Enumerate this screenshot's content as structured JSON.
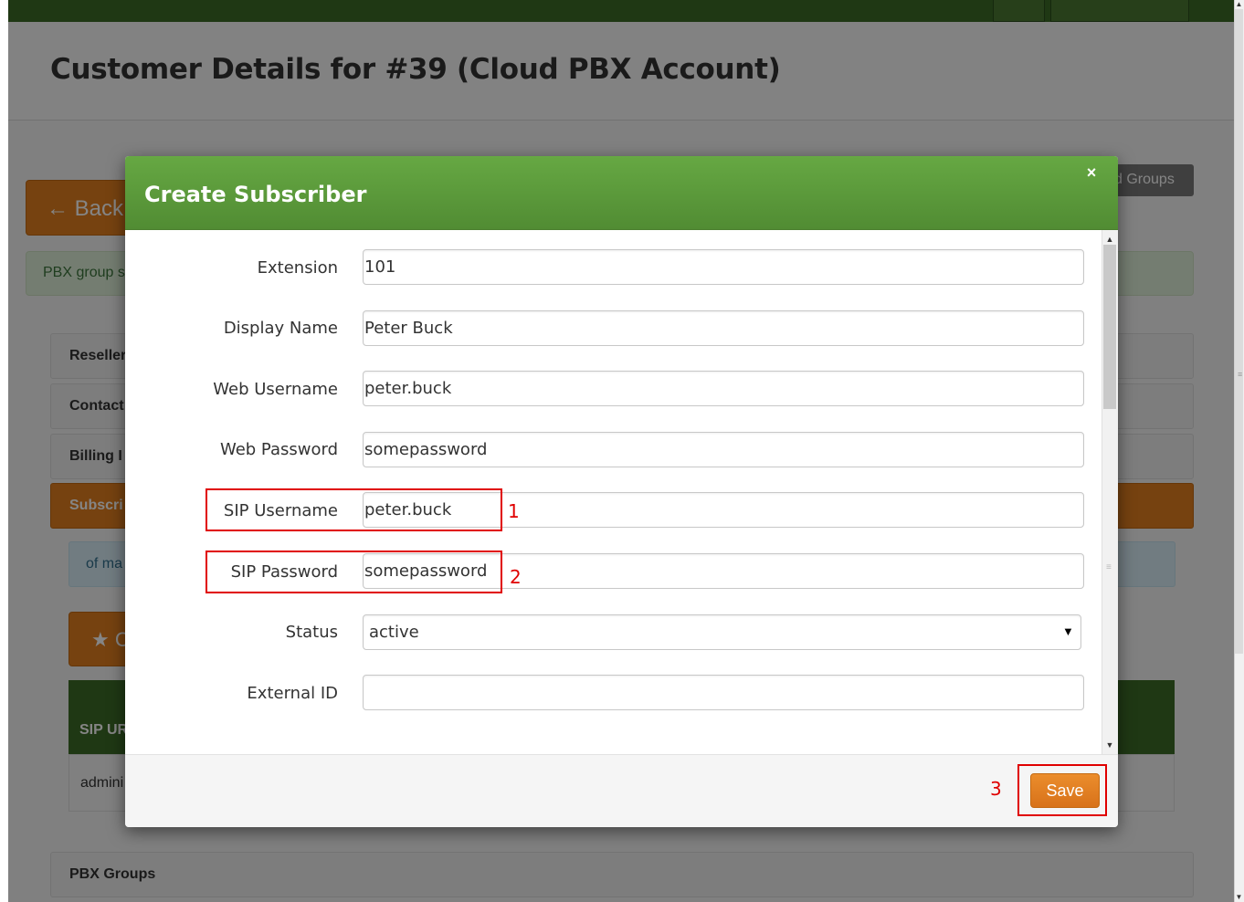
{
  "page": {
    "title": "Customer Details for #39 (Cloud PBX Account)",
    "back_label": "← Back",
    "groups_button": "d Groups",
    "info_text": "PBX group s",
    "panels": [
      "Reseller",
      "Contact",
      "Billing I",
      "Subscri"
    ],
    "alert_text": "of ma",
    "star_button": "★ C",
    "table_header": "SIP UR",
    "table_cell": "admini",
    "pbx_groups": "PBX Groups"
  },
  "modal": {
    "title": "Create Subscriber",
    "close": "×",
    "fields": [
      {
        "label": "Extension",
        "value": "101"
      },
      {
        "label": "Display Name",
        "value": "Peter Buck"
      },
      {
        "label": "Web Username",
        "value": "peter.buck"
      },
      {
        "label": "Web Password",
        "value": "somepassword"
      },
      {
        "label": "SIP Username",
        "value": "peter.buck"
      },
      {
        "label": "SIP Password",
        "value": "somepassword"
      },
      {
        "label": "Status",
        "value": "active"
      },
      {
        "label": "External ID",
        "value": ""
      }
    ],
    "save_label": "Save"
  },
  "annotations": [
    "1",
    "2",
    "3"
  ],
  "colors": {
    "header_green": "#5c9a3c",
    "accent_orange": "#e27f1f",
    "annotation_red": "#e00000"
  }
}
